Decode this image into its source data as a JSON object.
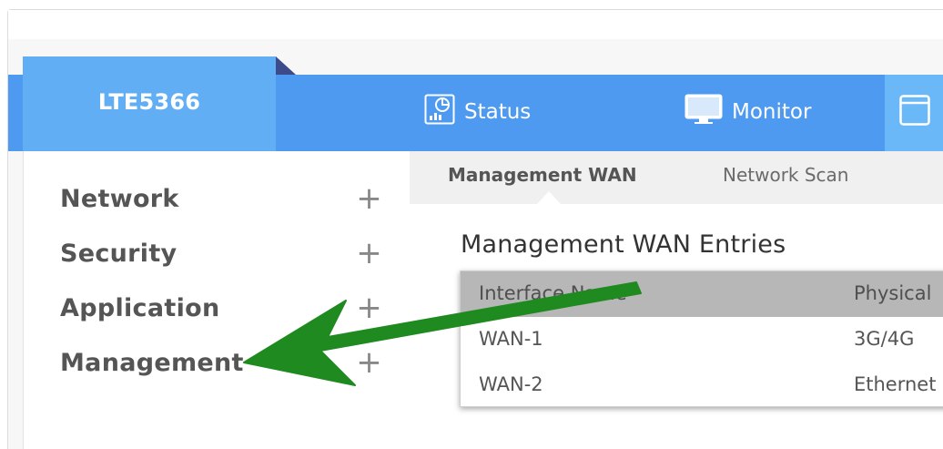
{
  "brand": {
    "name": "LTE5366"
  },
  "nav": {
    "items": [
      {
        "label": "Status",
        "icon": "status-chart-icon"
      },
      {
        "label": "Monitor",
        "icon": "monitor-icon"
      },
      {
        "label": "",
        "icon": "configuration-icon"
      }
    ]
  },
  "sidebar": {
    "items": [
      {
        "label": "Network",
        "expand": "+"
      },
      {
        "label": "Security",
        "expand": "+"
      },
      {
        "label": "Application",
        "expand": "+"
      },
      {
        "label": "Management",
        "expand": "+"
      }
    ]
  },
  "subtabs": {
    "items": [
      {
        "label": "Management WAN",
        "active": true
      },
      {
        "label": "Network Scan",
        "active": false
      }
    ]
  },
  "main": {
    "title": "Management WAN Entries",
    "table": {
      "columns": [
        "Interface Name",
        "Physical"
      ],
      "rows": [
        [
          "WAN-1",
          "3G/4G"
        ],
        [
          "WAN-2",
          "Ethernet"
        ]
      ]
    }
  },
  "colors": {
    "header_blue": "#4d9af0",
    "brand_tab": "#62aef5",
    "annotation_arrow": "#1f8a1f"
  }
}
